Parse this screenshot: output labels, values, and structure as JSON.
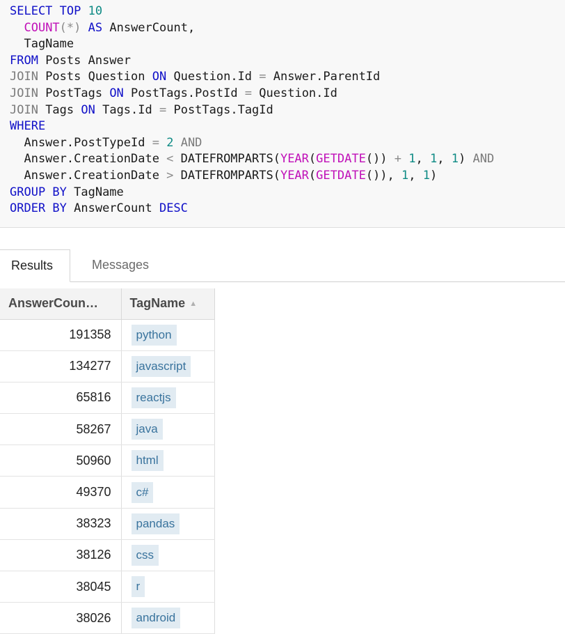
{
  "editor": {
    "lines": [
      [
        {
          "t": "SELECT TOP ",
          "c": "kw"
        },
        {
          "t": "10",
          "c": "num"
        }
      ],
      [
        {
          "t": "  "
        },
        {
          "t": "COUNT",
          "c": "fn"
        },
        {
          "t": "(*)",
          "c": "op"
        },
        {
          "t": " "
        },
        {
          "t": "AS",
          "c": "kw"
        },
        {
          "t": " AnswerCount,"
        }
      ],
      [
        {
          "t": "  TagName"
        }
      ],
      [
        {
          "t": "FROM",
          "c": "kw"
        },
        {
          "t": " Posts Answer"
        }
      ],
      [
        {
          "t": "JOIN",
          "c": "kg"
        },
        {
          "t": " Posts Question "
        },
        {
          "t": "ON",
          "c": "kw"
        },
        {
          "t": " Question.Id "
        },
        {
          "t": "=",
          "c": "op"
        },
        {
          "t": " Answer.ParentId"
        }
      ],
      [
        {
          "t": "JOIN",
          "c": "kg"
        },
        {
          "t": " PostTags "
        },
        {
          "t": "ON",
          "c": "kw"
        },
        {
          "t": " PostTags.PostId "
        },
        {
          "t": "=",
          "c": "op"
        },
        {
          "t": " Question.Id"
        }
      ],
      [
        {
          "t": "JOIN",
          "c": "kg"
        },
        {
          "t": " Tags "
        },
        {
          "t": "ON",
          "c": "kw"
        },
        {
          "t": " Tags.Id "
        },
        {
          "t": "=",
          "c": "op"
        },
        {
          "t": " PostTags.TagId"
        }
      ],
      [
        {
          "t": "WHERE",
          "c": "kw"
        }
      ],
      [
        {
          "t": "  Answer.PostTypeId "
        },
        {
          "t": "=",
          "c": "op"
        },
        {
          "t": " "
        },
        {
          "t": "2",
          "c": "num"
        },
        {
          "t": " "
        },
        {
          "t": "AND",
          "c": "kg"
        }
      ],
      [
        {
          "t": "  Answer.CreationDate "
        },
        {
          "t": "<",
          "c": "op"
        },
        {
          "t": " DATEFROMPARTS("
        },
        {
          "t": "YEAR",
          "c": "fn"
        },
        {
          "t": "("
        },
        {
          "t": "GETDATE",
          "c": "fn"
        },
        {
          "t": "()) "
        },
        {
          "t": "+",
          "c": "op"
        },
        {
          "t": " "
        },
        {
          "t": "1",
          "c": "num"
        },
        {
          "t": ", "
        },
        {
          "t": "1",
          "c": "num"
        },
        {
          "t": ", "
        },
        {
          "t": "1",
          "c": "num"
        },
        {
          "t": ") "
        },
        {
          "t": "AND",
          "c": "kg"
        }
      ],
      [
        {
          "t": "  Answer.CreationDate "
        },
        {
          "t": ">",
          "c": "op"
        },
        {
          "t": " DATEFROMPARTS("
        },
        {
          "t": "YEAR",
          "c": "fn"
        },
        {
          "t": "("
        },
        {
          "t": "GETDATE",
          "c": "fn"
        },
        {
          "t": "()), "
        },
        {
          "t": "1",
          "c": "num"
        },
        {
          "t": ", "
        },
        {
          "t": "1",
          "c": "num"
        },
        {
          "t": ")"
        }
      ],
      [
        {
          "t": "GROUP BY",
          "c": "kw"
        },
        {
          "t": " TagName"
        }
      ],
      [
        {
          "t": "ORDER BY",
          "c": "kw"
        },
        {
          "t": " AnswerCount "
        },
        {
          "t": "DESC",
          "c": "kw"
        }
      ]
    ]
  },
  "tabs": {
    "results": "Results",
    "messages": "Messages",
    "active": "Results"
  },
  "grid": {
    "columns": [
      "AnswerCoun…",
      "TagName"
    ],
    "sorted_column": "TagName",
    "sort_icon": "sort-up-icon",
    "rows": [
      {
        "count": "191358",
        "tag": "python"
      },
      {
        "count": "134277",
        "tag": "javascript"
      },
      {
        "count": "65816",
        "tag": "reactjs"
      },
      {
        "count": "58267",
        "tag": "java"
      },
      {
        "count": "50960",
        "tag": "html"
      },
      {
        "count": "49370",
        "tag": "c#"
      },
      {
        "count": "38323",
        "tag": "pandas"
      },
      {
        "count": "38126",
        "tag": "css"
      },
      {
        "count": "38045",
        "tag": "r"
      },
      {
        "count": "38026",
        "tag": "android"
      }
    ]
  },
  "colors": {
    "keyword": "#1010c8",
    "function": "#c010b8",
    "number": "#0d8a84",
    "tag_bg": "#e1ebf2",
    "tag_text": "#39739d"
  }
}
